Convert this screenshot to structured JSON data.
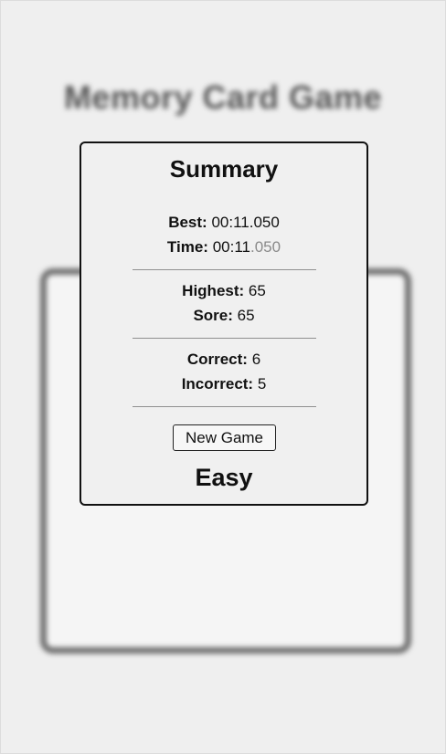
{
  "background": {
    "title": "Memory Card Game"
  },
  "summary": {
    "title": "Summary",
    "best_label": "Best:",
    "best_value": "00:11.050",
    "time_label": "Time:",
    "time_value_main": "00:11",
    "time_value_ms": ".050",
    "highest_label": "Highest:",
    "highest_value": "65",
    "score_label": "Sore:",
    "score_value": "65",
    "correct_label": "Correct:",
    "correct_value": "6",
    "incorrect_label": "Incorrect:",
    "incorrect_value": "5",
    "new_game_label": "New Game",
    "difficulty": "Easy"
  },
  "colors": {
    "background": "#efefef",
    "modal_background": "#f0f0f0",
    "modal_border": "#111111",
    "milliseconds_text": "#8a8a8a"
  }
}
